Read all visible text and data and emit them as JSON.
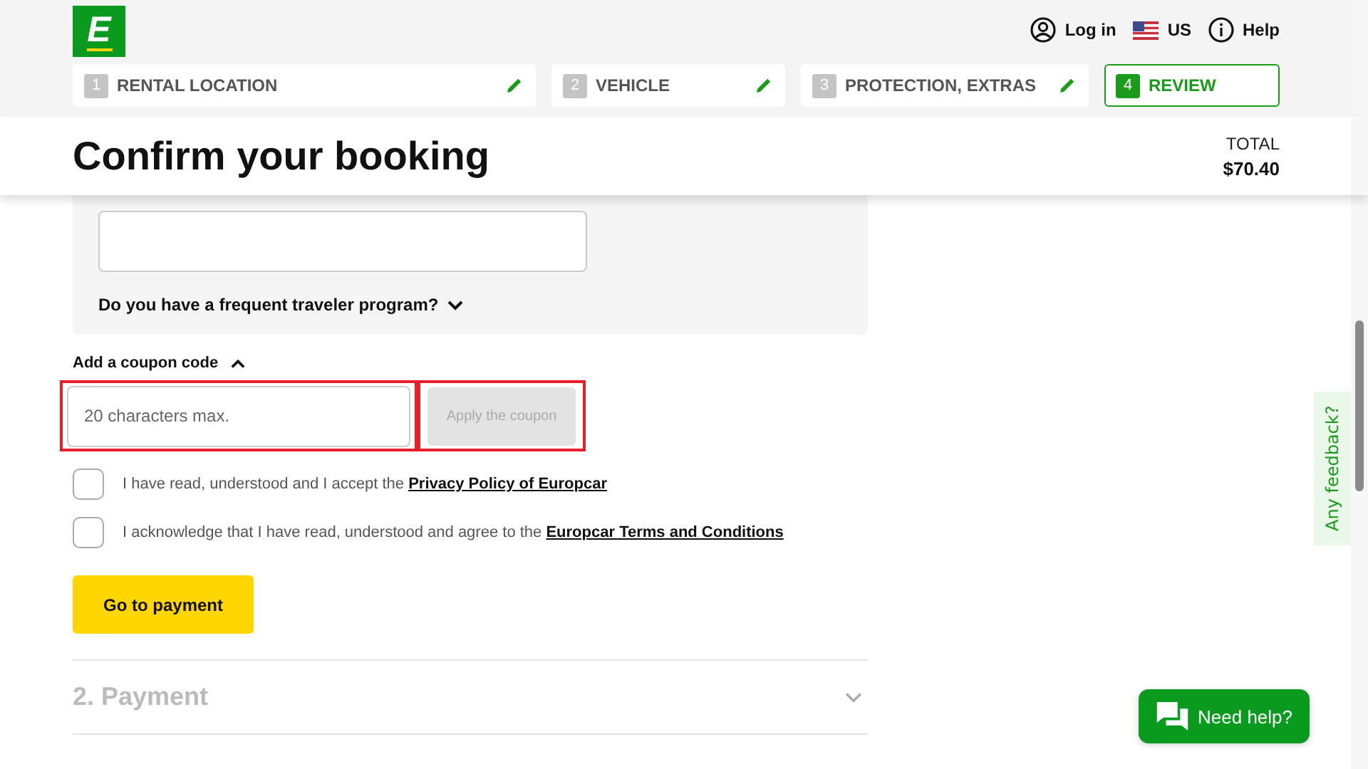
{
  "header": {
    "logo": "E",
    "nav": [
      {
        "kind": "account",
        "label": "Log in"
      },
      {
        "kind": "flag",
        "label": "US"
      },
      {
        "kind": "info",
        "label": "Help"
      }
    ]
  },
  "steps": [
    {
      "number": "1",
      "label": "RENTAL LOCATION",
      "selected": false
    },
    {
      "number": "2",
      "label": "VEHICLE",
      "selected": false
    },
    {
      "number": "3",
      "label": "PROTECTION, EXTRAS",
      "selected": false
    },
    {
      "number": "4",
      "label": "REVIEW",
      "selected": true
    }
  ],
  "title": "Confirm your booking",
  "total": {
    "label": "TOTAL",
    "amount": "$70.40"
  },
  "frequent_traveler": {
    "label": "Do you have a frequent traveler program?",
    "expanded": false
  },
  "coupon": {
    "label": "Add a coupon code",
    "expanded": true,
    "placeholder": "20 characters max.",
    "button": "Apply the coupon",
    "button_disabled": true
  },
  "consents": [
    {
      "text": "I have read, understood and I accept the ",
      "link": "Privacy Policy of Europcar",
      "checked": false
    },
    {
      "text": "I acknowledge that I have read, understood and agree to the ",
      "link": "Europcar Terms and Conditions",
      "checked": false
    }
  ],
  "primary_button": "Go to payment",
  "next_section": {
    "title": "2. Payment",
    "expanded": false
  },
  "feedback_tab": "Any feedback?",
  "help_button": "Need help?"
}
